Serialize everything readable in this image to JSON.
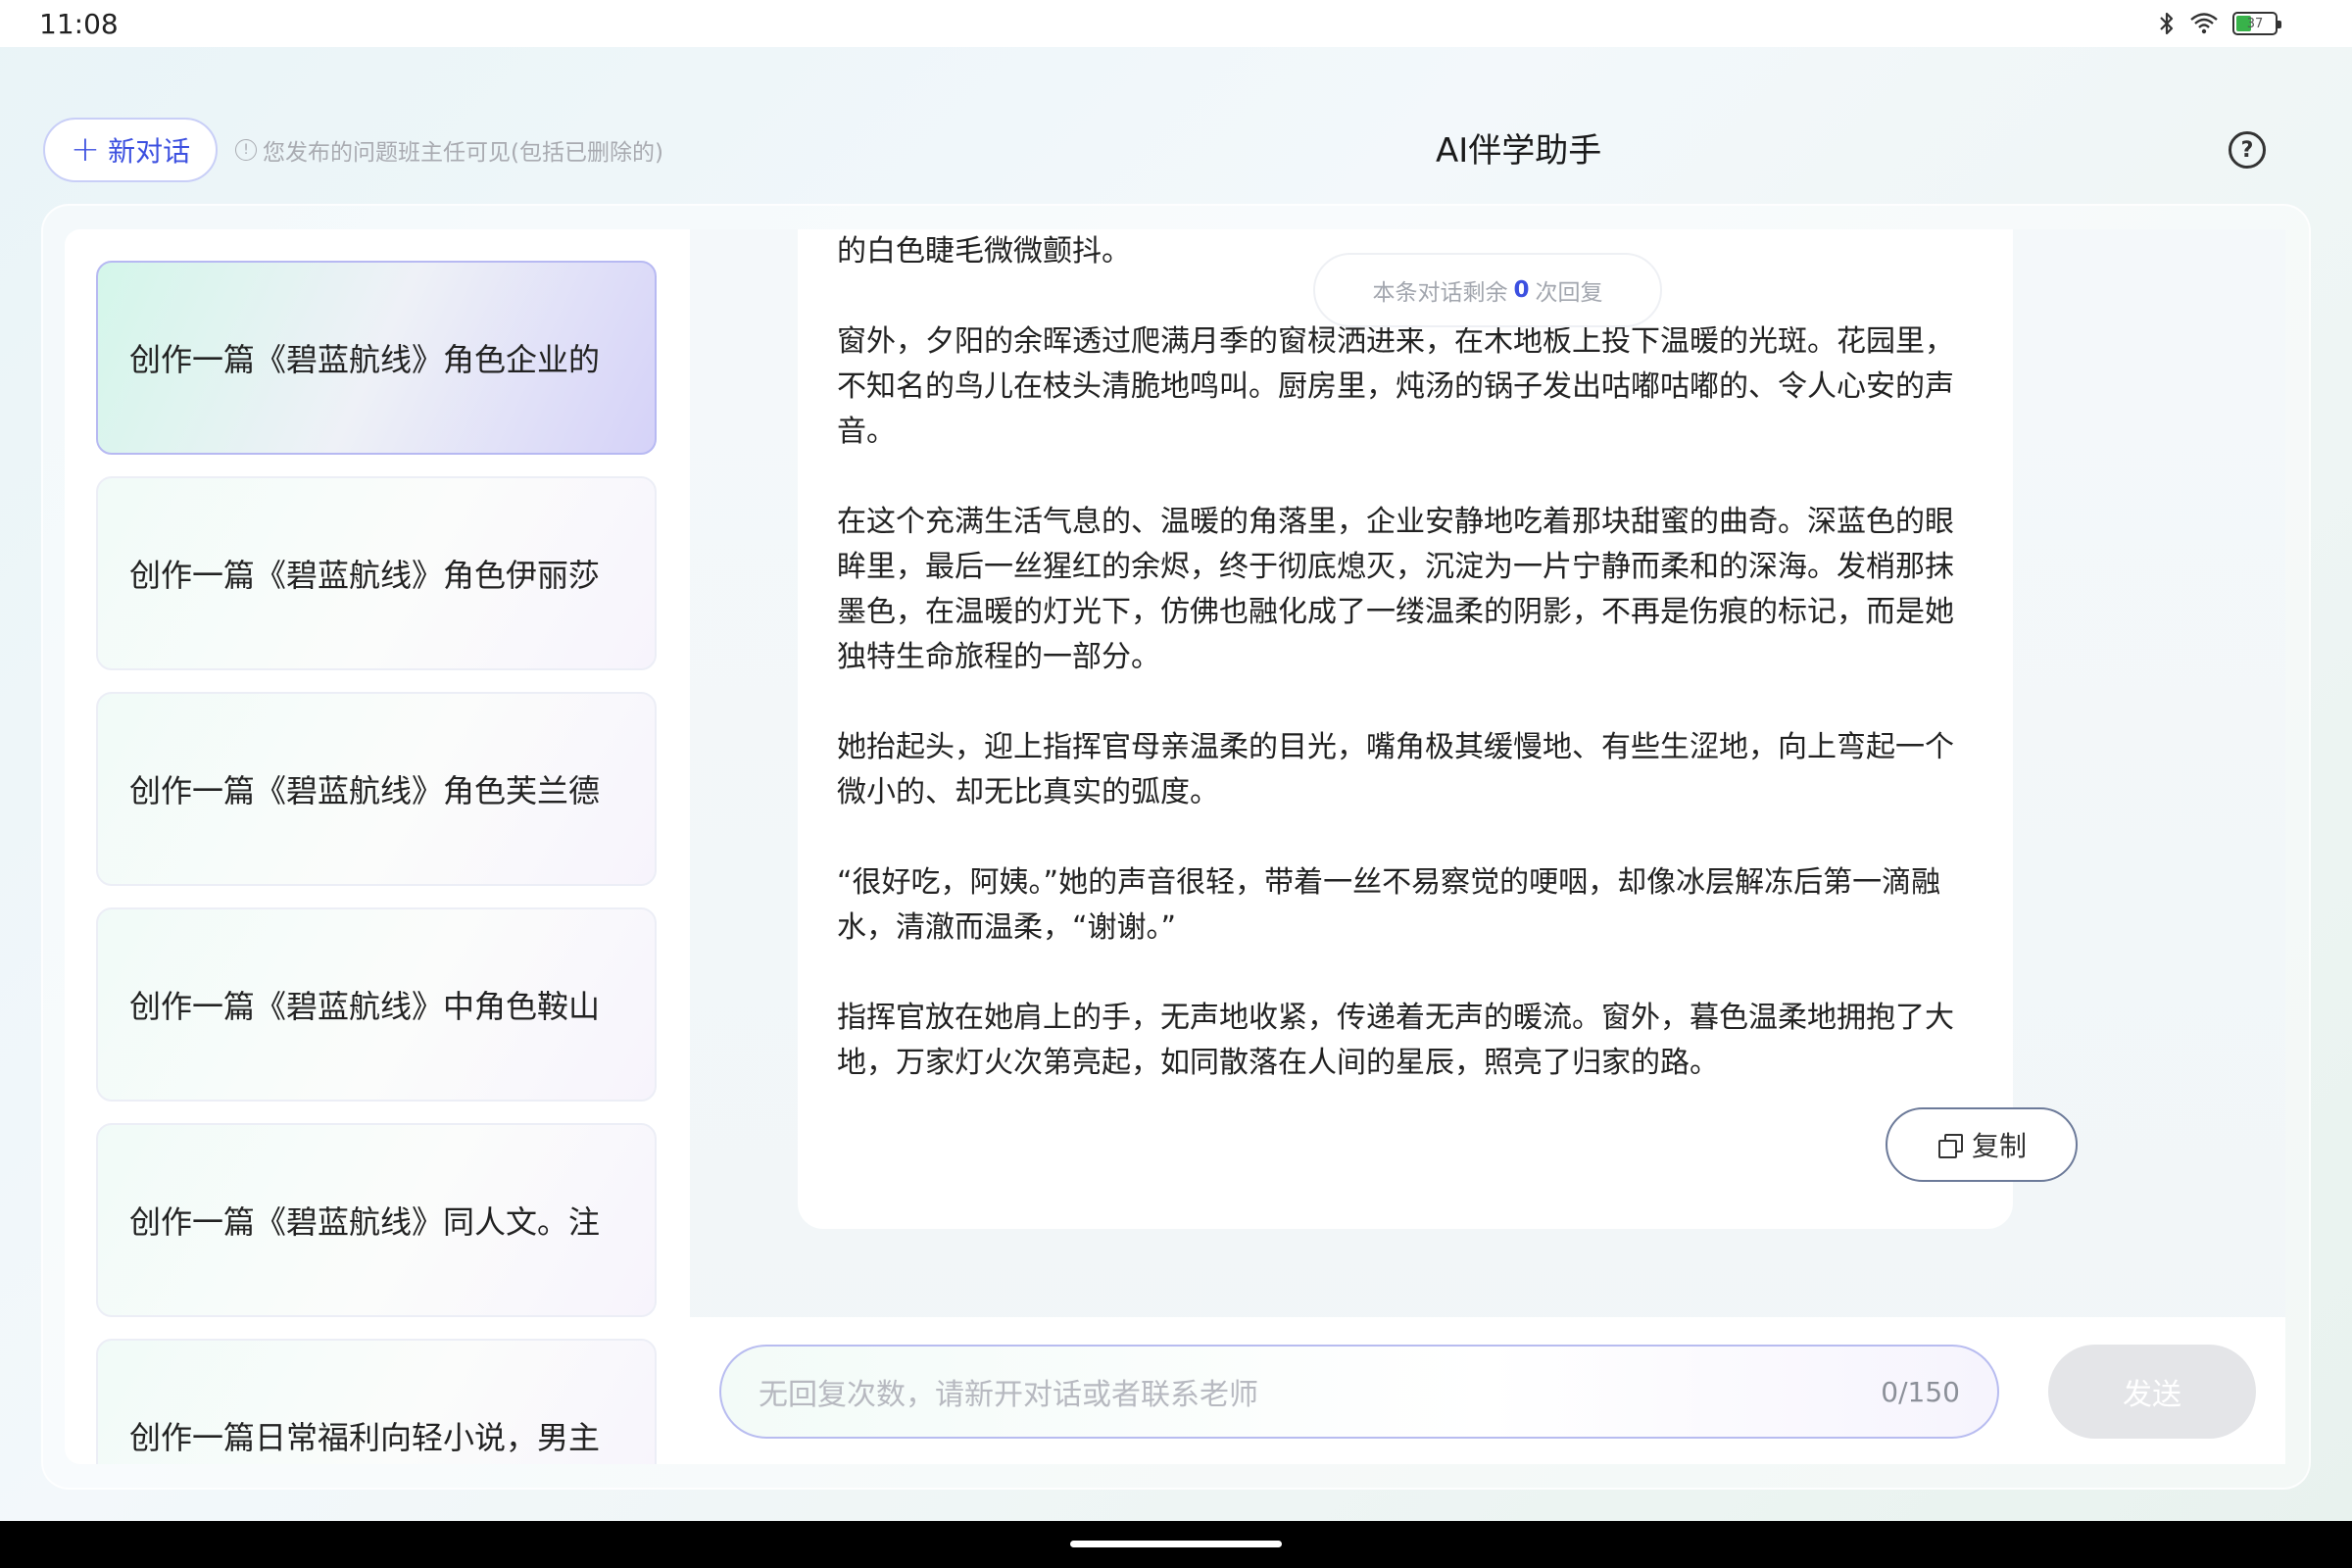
{
  "status_bar": {
    "time": "11:08",
    "battery_level": "37",
    "icons": [
      "bluetooth-icon",
      "wifi-icon",
      "battery-icon"
    ]
  },
  "header": {
    "new_chat_label": "新对话",
    "notice": "您发布的问题班主任可见(包括已删除的)",
    "title": "AI伴学助手",
    "help_icon": "?"
  },
  "conversations": [
    {
      "title": "创作一篇《碧蓝航线》角色企业的",
      "active": true
    },
    {
      "title": "创作一篇《碧蓝航线》角色伊丽莎",
      "active": false
    },
    {
      "title": "创作一篇《碧蓝航线》角色芙兰德",
      "active": false
    },
    {
      "title": "创作一篇《碧蓝航线》中角色鞍山",
      "active": false
    },
    {
      "title": "创作一篇《碧蓝航线》同人文。注",
      "active": false
    },
    {
      "title": "创作一篇日常福利向轻小说，男主",
      "active": false
    }
  ],
  "chat": {
    "remaining_prefix": "本条对话剩余",
    "remaining_count": "0",
    "remaining_suffix": "次回复",
    "paragraphs": [
      "的白色睫毛微微颤抖。",
      "窗外，夕阳的余晖透过爬满月季的窗棂洒进来，在木地板上投下温暖的光斑。花园里，不知名的鸟儿在枝头清脆地鸣叫。厨房里，炖汤的锅子发出咕嘟咕嘟的、令人心安的声音。",
      "在这个充满生活气息的、温暖的角落里，企业安静地吃着那块甜蜜的曲奇。深蓝色的眼眸里，最后一丝猩红的余烬，终于彻底熄灭，沉淀为一片宁静而柔和的深海。发梢那抹墨色，在温暖的灯光下，仿佛也融化成了一缕温柔的阴影，不再是伤痕的标记，而是她独特生命旅程的一部分。",
      "她抬起头，迎上指挥官母亲温柔的目光，嘴角极其缓慢地、有些生涩地，向上弯起一个微小的、却无比真实的弧度。",
      "“很好吃，阿姨。”她的声音很轻，带着一丝不易察觉的哽咽，却像冰层解冻后第一滴融水，清澈而温柔，“谢谢。”",
      "指挥官放在她肩上的手，无声地收紧，传递着无声的暖流。窗外，暮色温柔地拥抱了大地，万家灯火次第亮起，如同散落在人间的星辰，照亮了归家的路。"
    ],
    "copy_label": "复制"
  },
  "input": {
    "placeholder": "无回复次数，请新开对话或者联系老师",
    "char_count": "0/150",
    "send_label": "发送"
  }
}
